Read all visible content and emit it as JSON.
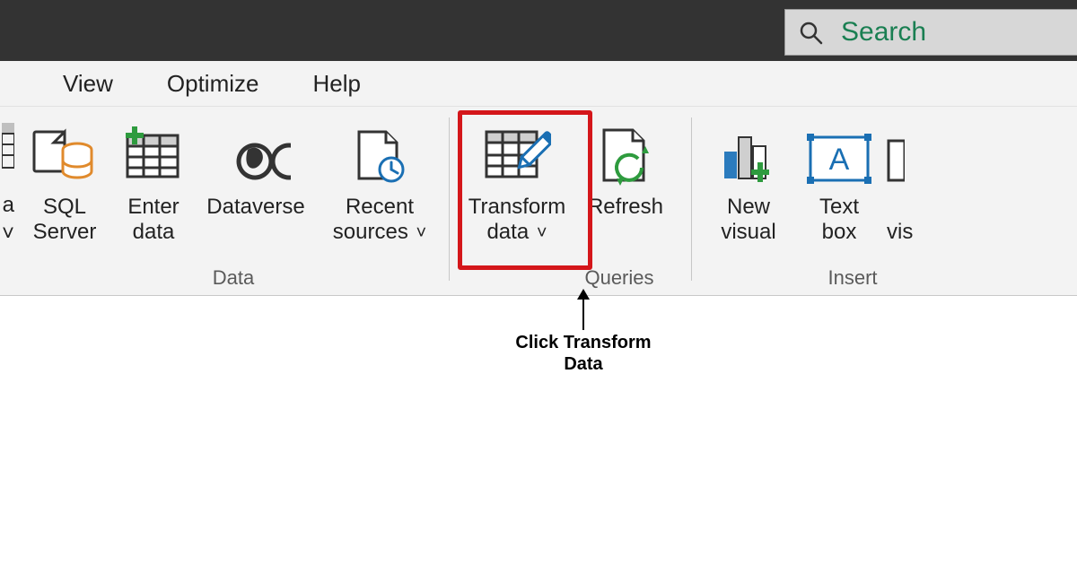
{
  "title_bar": {
    "search_label": "Search"
  },
  "tabs": {
    "view": "View",
    "optimize": "Optimize",
    "help": "Help"
  },
  "ribbon": {
    "left_fragments": {
      "top": "a",
      "bottom_chevron": "˅"
    },
    "data_group": {
      "sql_server": {
        "line1": "SQL",
        "line2": "Server"
      },
      "enter_data": {
        "line1": "Enter",
        "line2": "data"
      },
      "dataverse": {
        "line1": "Dataverse"
      },
      "recent_sources": {
        "line1": "Recent",
        "line2": "sources",
        "has_dropdown": true
      },
      "group_label": "Data"
    },
    "queries_group": {
      "transform_data": {
        "line1": "Transform",
        "line2": "data",
        "has_dropdown": true
      },
      "refresh": {
        "line1": "Refresh"
      },
      "group_label": "Queries"
    },
    "insert_group": {
      "new_visual": {
        "line1": "New",
        "line2": "visual"
      },
      "text_box": {
        "line1": "Text",
        "line2": "box"
      },
      "cut_fragment": {
        "line2": "vis"
      },
      "group_label": "Insert"
    }
  },
  "annotation": {
    "line1": "Click Transform",
    "line2": "Data"
  }
}
